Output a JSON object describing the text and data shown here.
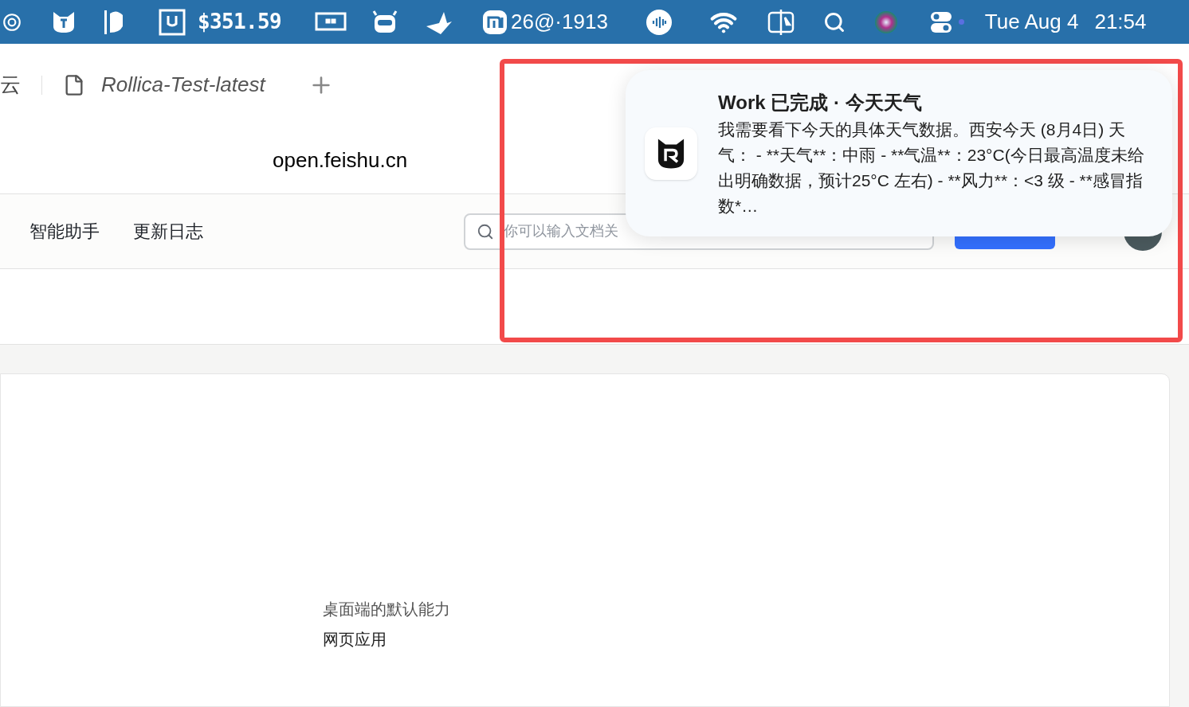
{
  "menu_bar": {
    "stock_price": "$351.59",
    "mi_status": "26@·1913",
    "date": "Tue Aug 4",
    "time": "21:54"
  },
  "browser": {
    "tabs": [
      {
        "title": "云",
        "selected": false
      },
      {
        "title": "Rollica-Test-latest",
        "selected": true
      }
    ],
    "address": "open.feishu.cn"
  },
  "site_nav": {
    "items": [
      "智能助手",
      "更新日志"
    ],
    "search": {
      "placeholder": "你可以输入文档关"
    }
  },
  "content": {
    "lines": [
      "桌面端的默认能力",
      "网页应用"
    ]
  },
  "notification": {
    "title": "Work 已完成 · 今天天气",
    "body": "我需要看下今天的具体天气数据。西安今天 (8月4日) 天气： - **天气**：中雨 - **气温**：23°C(今日最高温度未给出明确数据，预计25°C 左右) - **风力**：<3 级 - **感冒指数*…"
  }
}
